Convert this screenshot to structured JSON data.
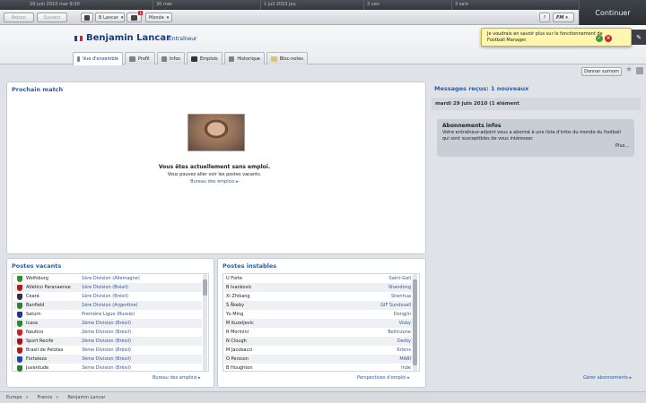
{
  "timeline": {
    "date": "29 juin 2010 mar 9:00",
    "marks": [
      "30 mer",
      "1 juil 2010 jeu",
      "2 ven",
      "3 sam"
    ]
  },
  "continue_label": "Continuer",
  "toolbar": {
    "back": "Retour",
    "forward": "Suivant",
    "profile_menu": "B Lancar",
    "inbox_count": "1",
    "world_menu": "Monde",
    "help": "?",
    "fm_menu": "FM"
  },
  "player": {
    "name": "Benjamin Lancar",
    "role": "Entraîneur",
    "flag_colors": [
      "#1f3f9a",
      "#ffffff",
      "#d6202a"
    ]
  },
  "tabs": [
    {
      "label": "Vue d'ensemble",
      "icon": "home-icon"
    },
    {
      "label": "Profil",
      "icon": "profile-icon"
    },
    {
      "label": "Infos",
      "icon": "news-icon"
    },
    {
      "label": "Emplois",
      "icon": "briefcase-icon"
    },
    {
      "label": "Historique",
      "icon": "history-icon"
    },
    {
      "label": "Bloc-notes",
      "icon": "notepad-icon"
    }
  ],
  "notification": {
    "text": "Je voudrais en savoir plus sur le fonctionnement de Football Manager."
  },
  "offer_button": "Donner surnom",
  "next_match": {
    "title": "Prochain match",
    "line1": "Vous êtes actuellement sans emploi.",
    "line2": "Vous pouvez aller voir les postes vacants.",
    "link": "Bureau des emplois ▸"
  },
  "vacancies": {
    "title": "Postes vacants",
    "rows": [
      {
        "club": "Wolfsburg",
        "division": "1ère Division (Allemagne)",
        "color": "#3a8a3a"
      },
      {
        "club": "Atlético Paranaense",
        "division": "1ère Division (Brésil)",
        "color": "#b01a1a"
      },
      {
        "club": "Ceará",
        "division": "1ère Division (Brésil)",
        "color": "#333333"
      },
      {
        "club": "Banfield",
        "division": "1ère Division (Argentine)",
        "color": "#2e7d32"
      },
      {
        "club": "Saturn",
        "division": "Première Ligue (Russie)",
        "color": "#1a3a8a"
      },
      {
        "club": "Icasa",
        "division": "2ème Division (Brésil)",
        "color": "#2a8a3a"
      },
      {
        "club": "Náutico",
        "division": "2ème Division (Brésil)",
        "color": "#c62828"
      },
      {
        "club": "Sport Recife",
        "division": "2ème Division (Brésil)",
        "color": "#a01818"
      },
      {
        "club": "Brasil de Pelotas",
        "division": "3ème Division (Brésil)",
        "color": "#b71c1c"
      },
      {
        "club": "Fortaleza",
        "division": "3ème Division (Brésil)",
        "color": "#1a4aa0"
      },
      {
        "club": "Juventude",
        "division": "3ème Division (Brésil)",
        "color": "#2e7d32"
      }
    ],
    "link": "Bureau des emplois ▸"
  },
  "unstable": {
    "title": "Postes instables",
    "rows": [
      {
        "manager": "U Forte",
        "club": "Saint-Gall"
      },
      {
        "manager": "B Ivankovic",
        "club": "Shandong"
      },
      {
        "manager": "Xi Zhikang",
        "club": "Shenhua"
      },
      {
        "manager": "S Åkeby",
        "club": "GIF Sundsvall"
      },
      {
        "manager": "Yu Ming",
        "club": "Dongjin"
      },
      {
        "manager": "M Kuzeljevic",
        "club": "Visby"
      },
      {
        "manager": "R Morinini",
        "club": "Bellinzone"
      },
      {
        "manager": "N Clough",
        "club": "Derby"
      },
      {
        "manager": "M Jacobacci",
        "club": "Kriens"
      },
      {
        "manager": "O Persson",
        "club": "MABI"
      },
      {
        "manager": "B Houghton",
        "club": "Inde"
      }
    ],
    "link": "Perspectives d'emploi ▸"
  },
  "messages": {
    "title": "Messages reçus: 1 nouveaux",
    "date": "mardi 29 juin 2010 (1 élément",
    "item_title": "Abonnements infos",
    "item_body": "Votre entraîneur-adjoint vous a abonné à une liste d'infos du monde du football qui sont susceptibles de vous intéresser.",
    "more": "Plus...",
    "manage": "Gérer abonnements ▸"
  },
  "breadcrumb": [
    "Europe",
    "France",
    "Benjamin Lancar"
  ]
}
